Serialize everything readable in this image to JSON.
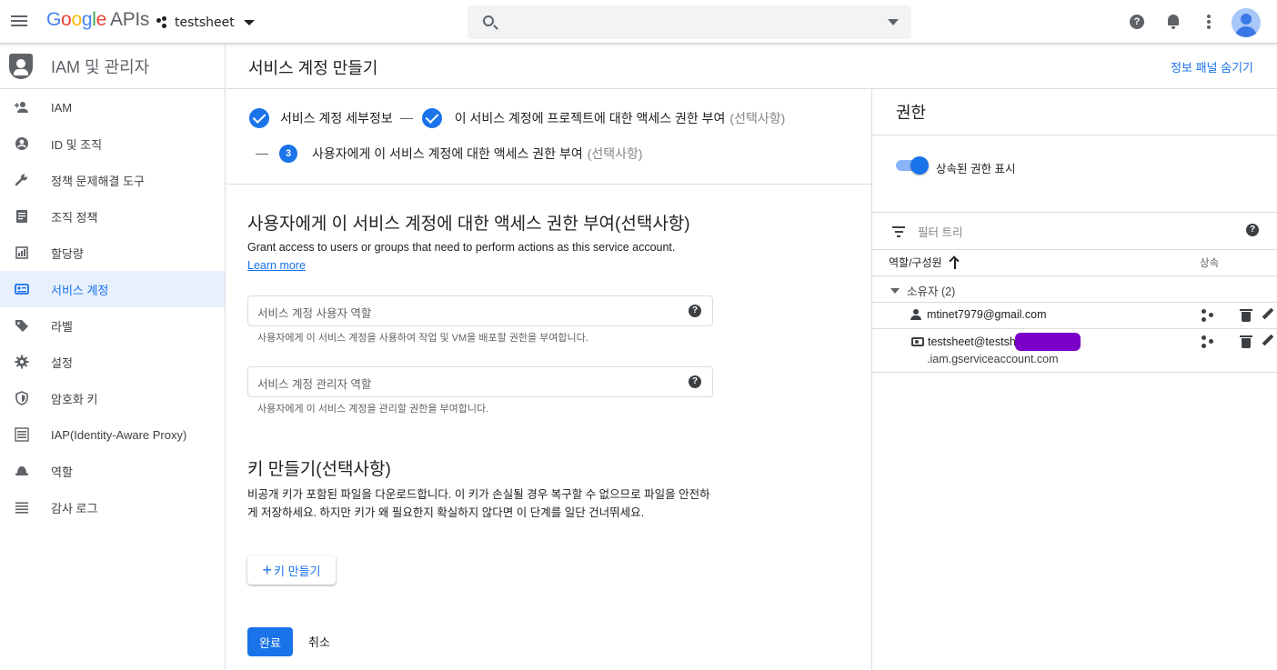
{
  "topbar": {
    "logo_google": "Google",
    "logo_apis": "APIs",
    "project": "testsheet"
  },
  "sidebar": {
    "title": "IAM 및 관리자",
    "items": [
      {
        "label": "IAM",
        "icon": "person-add-icon"
      },
      {
        "label": "ID 및 조직",
        "icon": "account-circle-icon"
      },
      {
        "label": "정책 문제해결 도구",
        "icon": "wrench-icon"
      },
      {
        "label": "조직 정책",
        "icon": "policy-document-icon"
      },
      {
        "label": "할당량",
        "icon": "quota-icon"
      },
      {
        "label": "서비스 계정",
        "icon": "service-account-icon",
        "active": true
      },
      {
        "label": "라벨",
        "icon": "label-tag-icon"
      },
      {
        "label": "설정",
        "icon": "gear-icon"
      },
      {
        "label": "암호화 키",
        "icon": "security-shield-icon"
      },
      {
        "label": "IAP(Identity-Aware Proxy)",
        "icon": "iap-icon"
      },
      {
        "label": "역할",
        "icon": "roles-hat-icon"
      },
      {
        "label": "감사 로그",
        "icon": "list-icon"
      }
    ]
  },
  "main": {
    "page_title": "서비스 계정 만들기",
    "hide_panel": "정보 패널 숨기기",
    "steps": [
      {
        "label": "서비스 계정 세부정보",
        "status": "done"
      },
      {
        "label": "이 서비스 계정에 프로젝트에 대한 액세스 권한 부여",
        "optional": "(선택사항)",
        "status": "done"
      },
      {
        "number": "3",
        "label": "사용자에게 이 서비스 계정에 대한 액세스 권한 부여",
        "optional": "(선택사항)",
        "status": "current"
      }
    ],
    "section_title": "사용자에게 이 서비스 계정에 대한 액세스 권한 부여(선택사항)",
    "section_desc": "Grant access to users or groups that need to perform actions as this service account.",
    "learn_more": "Learn more",
    "field_user_role": {
      "placeholder": "서비스 계정 사용자 역할",
      "hint": "사용자에게 이 서비스 계정을 사용하여 작업 및 VM을 배포할 권한을 부여합니다."
    },
    "field_admin_role": {
      "placeholder": "서비스 계정 관리자 역할",
      "hint": "사용자에게 이 서비스 계정을 관리할 권한을 부여합니다."
    },
    "key_title": "키 만들기(선택사항)",
    "key_desc": "비공개 키가 포함된 파일을 다운로드합니다. 이 키가 손실될 경우 복구할 수 없으므로 파일을 안전하게 저장하세요. 하지만 키가 왜 필요한지 확실하지 않다면 이 단계를 일단 건너뛰세요.",
    "key_button": "키 만들기",
    "done_button": "완료",
    "cancel_button": "취소"
  },
  "panel": {
    "title": "권한",
    "toggle_label": "상속된 권한 표시",
    "toggle_on": true,
    "filter_placeholder": "필터 트리",
    "col_role": "역할/구성원",
    "col_inherit": "상속",
    "owner_group": "소유자 (2)",
    "members": [
      {
        "email": "mtinet7979@gmail.com",
        "type": "user"
      },
      {
        "email_prefix": "testsheet@testsh",
        "email_suffix": ".iam.gserviceaccount.com",
        "type": "service-account",
        "redacted": true
      }
    ]
  },
  "colors": {
    "accent": "#1a73e8",
    "active_bg": "#e8f0fe",
    "redaction": "#7a00c7"
  }
}
